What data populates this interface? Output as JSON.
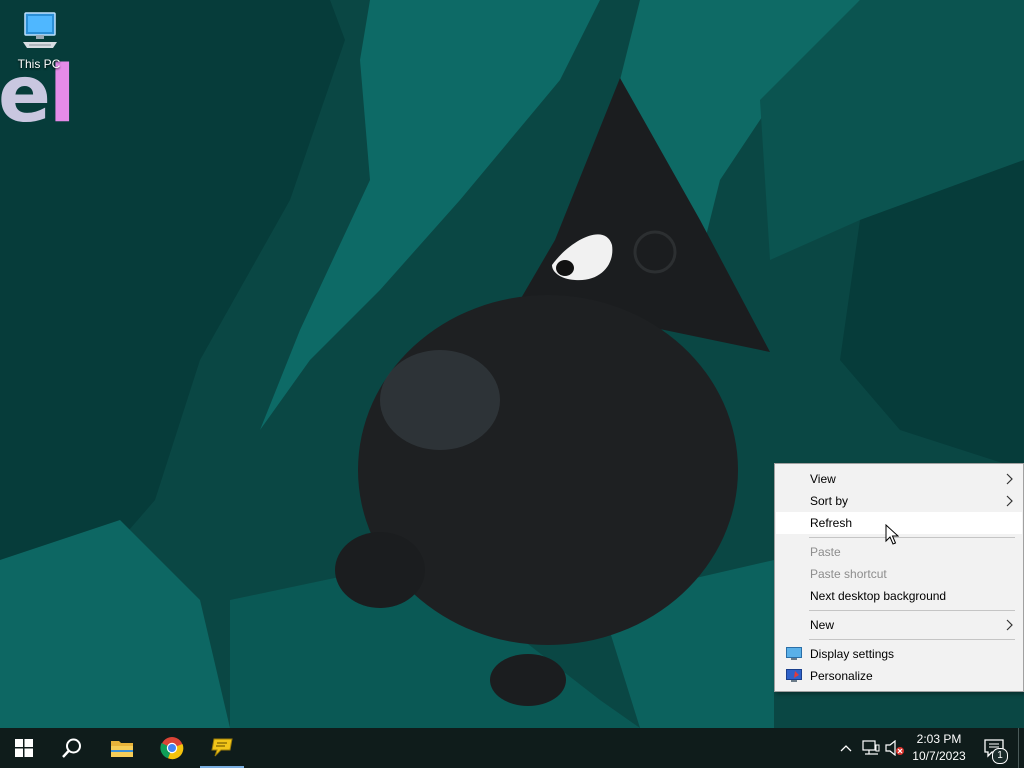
{
  "desktop": {
    "icons": [
      {
        "label": "This PC",
        "icon": "computer-icon"
      }
    ],
    "wallpaper_text": {
      "pre": "e",
      "post": "l"
    }
  },
  "context_menu": {
    "items": [
      {
        "label": "View",
        "submenu": true,
        "enabled": true
      },
      {
        "label": "Sort by",
        "submenu": true,
        "enabled": true
      },
      {
        "label": "Refresh",
        "submenu": false,
        "enabled": true,
        "highlighted": true
      },
      {
        "label": "Paste",
        "submenu": false,
        "enabled": false
      },
      {
        "label": "Paste shortcut",
        "submenu": false,
        "enabled": false
      },
      {
        "label": "Next desktop background",
        "submenu": false,
        "enabled": true
      },
      {
        "label": "New",
        "submenu": true,
        "enabled": true
      },
      {
        "label": "Display settings",
        "icon": "display-settings-icon",
        "enabled": true
      },
      {
        "label": "Personalize",
        "icon": "personalize-icon",
        "enabled": true
      }
    ],
    "submenu_glyph": ">"
  },
  "taskbar": {
    "apps": [
      "start-icon",
      "search-icon",
      "file-explorer-icon",
      "chrome-icon",
      "chat-app-icon"
    ],
    "clock": {
      "time": "2:03 PM",
      "date": "10/7/2023"
    },
    "notification_count": "1",
    "colors": {
      "taskbar_bg": "#0f1c1b",
      "accent": "#7aaee0"
    }
  }
}
